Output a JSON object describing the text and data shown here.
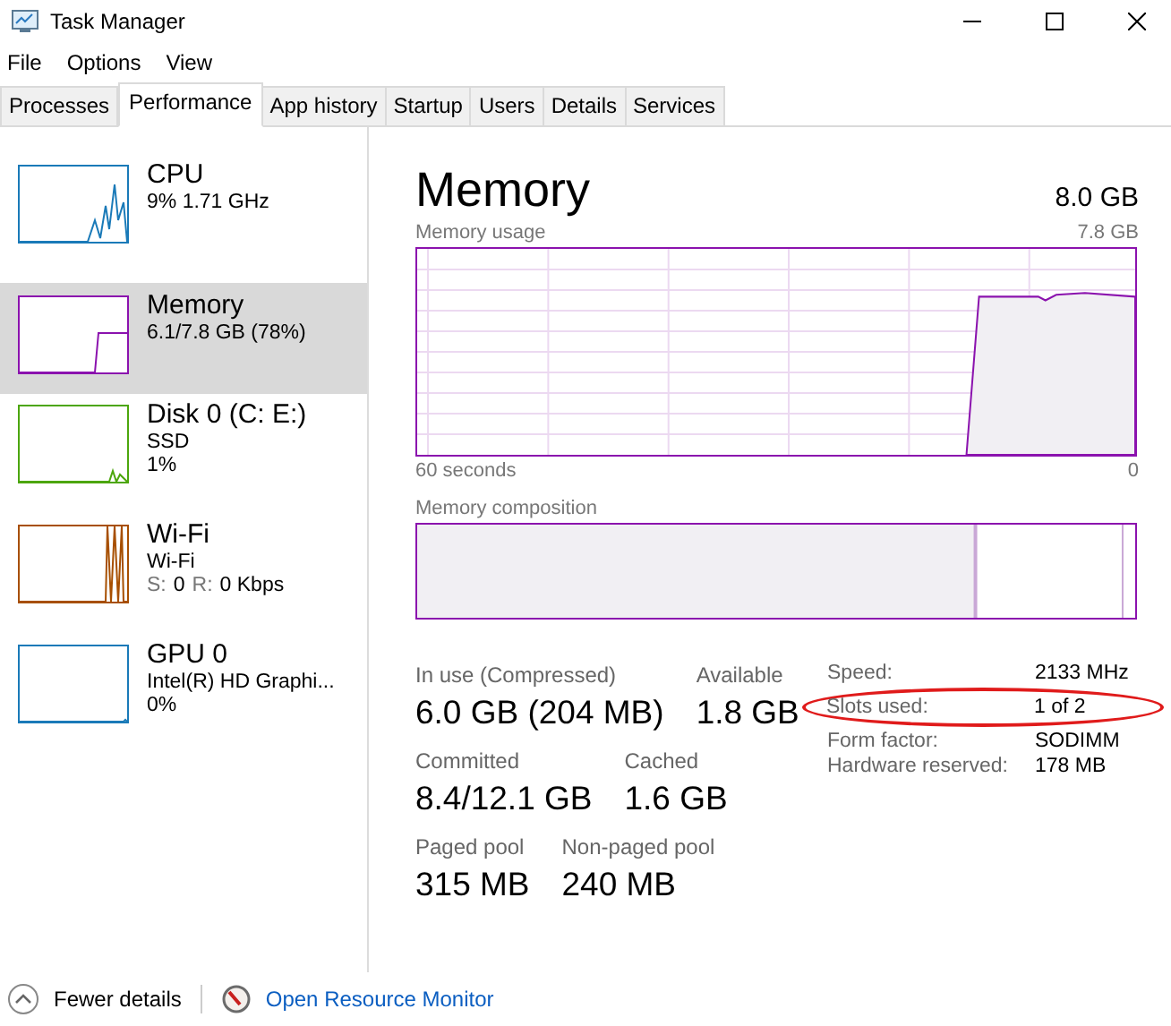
{
  "window": {
    "title": "Task Manager"
  },
  "menu": [
    "File",
    "Options",
    "View"
  ],
  "tabs": [
    {
      "label": "Processes",
      "selected": false
    },
    {
      "label": "Performance",
      "selected": true
    },
    {
      "label": "App history",
      "selected": false
    },
    {
      "label": "Startup",
      "selected": false
    },
    {
      "label": "Users",
      "selected": false
    },
    {
      "label": "Details",
      "selected": false
    },
    {
      "label": "Services",
      "selected": false
    }
  ],
  "sidebar": {
    "items": [
      {
        "name": "CPU",
        "color": "#1a7ab8",
        "selected": false,
        "lines": [
          {
            "kind": "text",
            "text": "9%  1.71 GHz"
          }
        ]
      },
      {
        "name": "Memory",
        "color": "#8b12ae",
        "selected": true,
        "lines": [
          {
            "kind": "text",
            "text": "6.1/7.8 GB (78%)"
          }
        ]
      },
      {
        "name": "Disk 0 (C: E:)",
        "color": "#4ca60c",
        "selected": false,
        "lines": [
          {
            "kind": "text",
            "text": "SSD"
          },
          {
            "kind": "text",
            "text": "1%"
          }
        ]
      },
      {
        "name": "Wi-Fi",
        "color": "#a74f01",
        "selected": false,
        "lines": [
          {
            "kind": "text",
            "text": "Wi-Fi"
          },
          {
            "kind": "pairs",
            "pairs": [
              {
                "label": "S:",
                "value": "0"
              },
              {
                "label": "R:",
                "value": "0 Kbps"
              }
            ]
          }
        ]
      },
      {
        "name": "GPU 0",
        "color": "#1a7ab8",
        "selected": false,
        "lines": [
          {
            "kind": "text",
            "text": "Intel(R) HD Graphi..."
          },
          {
            "kind": "text",
            "text": "0%"
          }
        ]
      }
    ]
  },
  "main": {
    "title": "Memory",
    "total": "8.0 GB",
    "usage_graph": {
      "label": "Memory usage",
      "max": "7.8 GB",
      "x_start": "60 seconds",
      "x_end": "0"
    },
    "composition": {
      "label": "Memory composition"
    },
    "stats": [
      [
        {
          "label": "In use (Compressed)",
          "value": "6.0 GB (204 MB)"
        },
        {
          "label": "Available",
          "value": "1.8 GB"
        }
      ],
      [
        {
          "label": "Committed",
          "value": "8.4/12.1 GB"
        },
        {
          "label": "Cached",
          "value": "1.6 GB"
        }
      ],
      [
        {
          "label": "Paged pool",
          "value": "315 MB"
        },
        {
          "label": "Non-paged pool",
          "value": "240 MB"
        }
      ]
    ],
    "details": [
      {
        "label": "Speed:",
        "value": "2133 MHz",
        "highlighted": false
      },
      {
        "label": "Slots used:",
        "value": "1 of 2",
        "highlighted": true
      },
      {
        "label": "Form factor:",
        "value": "SODIMM",
        "highlighted": false
      },
      {
        "label": "Hardware reserved:",
        "value": "178 MB",
        "highlighted": false
      }
    ]
  },
  "footer": {
    "fewer_details": "Fewer details",
    "link": "Open Resource Monitor"
  }
}
